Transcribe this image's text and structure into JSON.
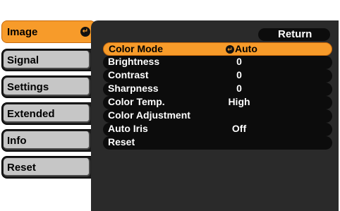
{
  "sidebar": {
    "items": [
      {
        "label": "Image",
        "selected": true
      },
      {
        "label": "Signal"
      },
      {
        "label": "Settings"
      },
      {
        "label": "Extended"
      },
      {
        "label": "Info"
      },
      {
        "label": "Reset"
      }
    ]
  },
  "panel": {
    "return_label": "Return",
    "rows": [
      {
        "name": "Color Mode",
        "value": "Auto",
        "selected": true
      },
      {
        "name": "Brightness",
        "value": "0"
      },
      {
        "name": "Contrast",
        "value": "0"
      },
      {
        "name": "Sharpness",
        "value": "0"
      },
      {
        "name": "Color Temp.",
        "value": "High"
      },
      {
        "name": "Color Adjustment",
        "value": ""
      },
      {
        "name": "Auto Iris",
        "value": "Off"
      },
      {
        "name": "Reset",
        "value": ""
      }
    ]
  },
  "icons": {
    "enter": "enter-return-icon"
  },
  "colors": {
    "accent": "#f79b2a",
    "panel": "#2a2a2a",
    "row": "#0c0c0c",
    "tab": "#c6c6c6"
  }
}
